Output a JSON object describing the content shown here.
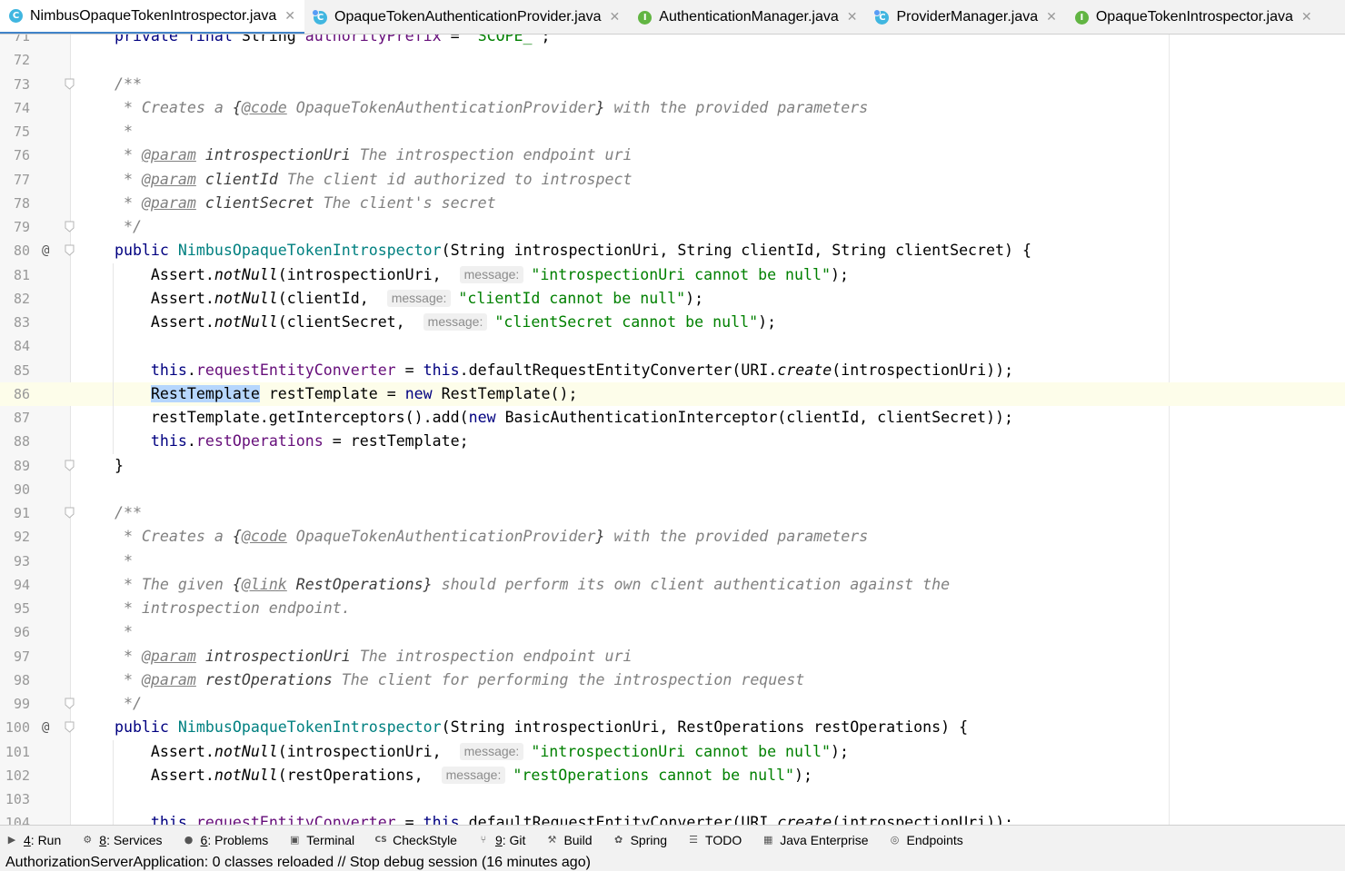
{
  "tabs": [
    {
      "label": "NimbusOpaqueTokenIntrospector.java",
      "icon": "class-icon",
      "kind": "C",
      "active": true
    },
    {
      "label": "OpaqueTokenAuthenticationProvider.java",
      "icon": "class-icon",
      "kind": "C",
      "active": false
    },
    {
      "label": "AuthenticationManager.java",
      "icon": "interface-icon",
      "kind": "I",
      "active": false
    },
    {
      "label": "ProviderManager.java",
      "icon": "class-icon",
      "kind": "C",
      "active": false
    },
    {
      "label": "OpaqueTokenIntrospector.java",
      "icon": "interface-icon",
      "kind": "I",
      "active": false
    }
  ],
  "editor": {
    "current_line": 86,
    "lines": [
      {
        "n": 71,
        "t": [
          [
            "kw",
            "    private final "
          ],
          [
            "",
            "String "
          ],
          [
            "fld",
            "authorityPrefix"
          ],
          [
            "",
            " = "
          ],
          [
            "str",
            "\"SCOPE_\""
          ],
          [
            "",
            ";"
          ]
        ]
      },
      {
        "n": 72,
        "t": []
      },
      {
        "n": 73,
        "fold": true,
        "t": [
          [
            "cm",
            "    /**"
          ]
        ]
      },
      {
        "n": 74,
        "t": [
          [
            "cm",
            "     * Creates a "
          ],
          [
            "par",
            "{"
          ],
          [
            "tag",
            "@code"
          ],
          [
            "cm",
            " OpaqueTokenAuthenticationProvider"
          ],
          [
            "par",
            "}"
          ],
          [
            "cm",
            " with the provided parameters"
          ]
        ]
      },
      {
        "n": 75,
        "t": [
          [
            "cm",
            "     *"
          ]
        ]
      },
      {
        "n": 76,
        "t": [
          [
            "cm",
            "     * "
          ],
          [
            "tag",
            "@param"
          ],
          [
            "cm",
            " "
          ],
          [
            "par",
            "introspectionUri"
          ],
          [
            "cm",
            " The introspection endpoint uri"
          ]
        ]
      },
      {
        "n": 77,
        "t": [
          [
            "cm",
            "     * "
          ],
          [
            "tag",
            "@param"
          ],
          [
            "cm",
            " "
          ],
          [
            "par",
            "clientId"
          ],
          [
            "cm",
            " The client id authorized to introspect"
          ]
        ]
      },
      {
        "n": 78,
        "t": [
          [
            "cm",
            "     * "
          ],
          [
            "tag",
            "@param"
          ],
          [
            "cm",
            " "
          ],
          [
            "par",
            "clientSecret"
          ],
          [
            "cm",
            " The client's secret"
          ]
        ]
      },
      {
        "n": 79,
        "fold": true,
        "t": [
          [
            "cm",
            "     */"
          ]
        ]
      },
      {
        "n": 80,
        "at": true,
        "fold": true,
        "t": [
          [
            "kw",
            "    public "
          ],
          [
            "mn",
            "NimbusOpaqueTokenIntrospector"
          ],
          [
            "",
            "(String introspectionUri, String clientId, String clientSecret) {"
          ]
        ]
      },
      {
        "n": 81,
        "t": [
          [
            "",
            "        Assert."
          ],
          [
            "mth",
            "notNull"
          ],
          [
            "",
            "(introspectionUri, "
          ],
          [
            "hint",
            "message:"
          ],
          [
            "str",
            "\"introspectionUri cannot be null\""
          ],
          [
            "",
            ");"
          ]
        ]
      },
      {
        "n": 82,
        "t": [
          [
            "",
            "        Assert."
          ],
          [
            "mth",
            "notNull"
          ],
          [
            "",
            "(clientId, "
          ],
          [
            "hint",
            "message:"
          ],
          [
            "str",
            "\"clientId cannot be null\""
          ],
          [
            "",
            ");"
          ]
        ]
      },
      {
        "n": 83,
        "t": [
          [
            "",
            "        Assert."
          ],
          [
            "mth",
            "notNull"
          ],
          [
            "",
            "(clientSecret, "
          ],
          [
            "hint",
            "message:"
          ],
          [
            "str",
            "\"clientSecret cannot be null\""
          ],
          [
            "",
            ");"
          ]
        ]
      },
      {
        "n": 84,
        "t": []
      },
      {
        "n": 85,
        "t": [
          [
            "kw",
            "        this"
          ],
          [
            "",
            "."
          ],
          [
            "fld",
            "requestEntityConverter"
          ],
          [
            "",
            " = "
          ],
          [
            "kw",
            "this"
          ],
          [
            "",
            ".defaultRequestEntityConverter(URI."
          ],
          [
            "mth",
            "create"
          ],
          [
            "",
            "(introspectionUri));"
          ]
        ]
      },
      {
        "n": 86,
        "t": [
          [
            "",
            "        "
          ],
          [
            "sel",
            "RestTemplate"
          ],
          [
            "",
            " restTemplate = "
          ],
          [
            "kw",
            "new "
          ],
          [
            "",
            "RestTemplate();"
          ]
        ]
      },
      {
        "n": 87,
        "t": [
          [
            "",
            "        restTemplate.getInterceptors().add("
          ],
          [
            "kw",
            "new "
          ],
          [
            "",
            "BasicAuthenticationInterceptor(clientId, clientSecret));"
          ]
        ]
      },
      {
        "n": 88,
        "t": [
          [
            "kw",
            "        this"
          ],
          [
            "",
            "."
          ],
          [
            "fld",
            "restOperations"
          ],
          [
            "",
            " = restTemplate;"
          ]
        ]
      },
      {
        "n": 89,
        "fold": true,
        "t": [
          [
            "",
            "    }"
          ]
        ]
      },
      {
        "n": 90,
        "t": []
      },
      {
        "n": 91,
        "fold": true,
        "t": [
          [
            "cm",
            "    /**"
          ]
        ]
      },
      {
        "n": 92,
        "t": [
          [
            "cm",
            "     * Creates a "
          ],
          [
            "par",
            "{"
          ],
          [
            "tag",
            "@code"
          ],
          [
            "cm",
            " OpaqueTokenAuthenticationProvider"
          ],
          [
            "par",
            "}"
          ],
          [
            "cm",
            " with the provided parameters"
          ]
        ]
      },
      {
        "n": 93,
        "t": [
          [
            "cm",
            "     *"
          ]
        ]
      },
      {
        "n": 94,
        "t": [
          [
            "cm",
            "     * The given "
          ],
          [
            "par",
            "{"
          ],
          [
            "tag",
            "@link"
          ],
          [
            "par",
            " RestOperations}"
          ],
          [
            "cm",
            " should perform its own client authentication against the"
          ]
        ]
      },
      {
        "n": 95,
        "t": [
          [
            "cm",
            "     * introspection endpoint."
          ]
        ]
      },
      {
        "n": 96,
        "t": [
          [
            "cm",
            "     *"
          ]
        ]
      },
      {
        "n": 97,
        "t": [
          [
            "cm",
            "     * "
          ],
          [
            "tag",
            "@param"
          ],
          [
            "cm",
            " "
          ],
          [
            "par",
            "introspectionUri"
          ],
          [
            "cm",
            " The introspection endpoint uri"
          ]
        ]
      },
      {
        "n": 98,
        "t": [
          [
            "cm",
            "     * "
          ],
          [
            "tag",
            "@param"
          ],
          [
            "cm",
            " "
          ],
          [
            "par",
            "restOperations"
          ],
          [
            "cm",
            " The client for performing the introspection request"
          ]
        ]
      },
      {
        "n": 99,
        "fold": true,
        "t": [
          [
            "cm",
            "     */"
          ]
        ]
      },
      {
        "n": 100,
        "at": true,
        "fold": true,
        "t": [
          [
            "kw",
            "    public "
          ],
          [
            "mn",
            "NimbusOpaqueTokenIntrospector"
          ],
          [
            "",
            "(String introspectionUri, RestOperations restOperations) {"
          ]
        ]
      },
      {
        "n": 101,
        "t": [
          [
            "",
            "        Assert."
          ],
          [
            "mth",
            "notNull"
          ],
          [
            "",
            "(introspectionUri, "
          ],
          [
            "hint",
            "message:"
          ],
          [
            "str",
            "\"introspectionUri cannot be null\""
          ],
          [
            "",
            ");"
          ]
        ]
      },
      {
        "n": 102,
        "t": [
          [
            "",
            "        Assert."
          ],
          [
            "mth",
            "notNull"
          ],
          [
            "",
            "(restOperations, "
          ],
          [
            "hint",
            "message:"
          ],
          [
            "str",
            "\"restOperations cannot be null\""
          ],
          [
            "",
            ");"
          ]
        ]
      },
      {
        "n": 103,
        "t": []
      },
      {
        "n": 104,
        "t": [
          [
            "kw",
            "        this"
          ],
          [
            "",
            "."
          ],
          [
            "fld",
            "requestEntityConverter"
          ],
          [
            "",
            " = "
          ],
          [
            "kw",
            "this"
          ],
          [
            "",
            ".defaultRequestEntityConverter(URI."
          ],
          [
            "mth",
            "create"
          ],
          [
            "",
            "(introspectionUri));"
          ]
        ]
      }
    ]
  },
  "toolstrip": [
    {
      "key": "4",
      "label": ": Run",
      "icon": "run-icon"
    },
    {
      "key": "8",
      "label": ": Services",
      "icon": "services-icon"
    },
    {
      "key": "6",
      "label": ": Problems",
      "icon": "problems-icon"
    },
    {
      "key": "",
      "label": "Terminal",
      "icon": "terminal-icon"
    },
    {
      "key": "",
      "label": "CheckStyle",
      "icon": "checkstyle-icon"
    },
    {
      "key": "9",
      "label": ": Git",
      "icon": "git-icon"
    },
    {
      "key": "",
      "label": "Build",
      "icon": "build-icon"
    },
    {
      "key": "",
      "label": "Spring",
      "icon": "spring-icon"
    },
    {
      "key": "",
      "label": "TODO",
      "icon": "todo-icon"
    },
    {
      "key": "",
      "label": "Java Enterprise",
      "icon": "java-enterprise-icon"
    },
    {
      "key": "",
      "label": "Endpoints",
      "icon": "endpoints-icon"
    }
  ],
  "status": {
    "message": "AuthorizationServerApplication: 0 classes reloaded // Stop debug session (16 minutes ago)"
  },
  "colors": {
    "keyword": "#000080",
    "string": "#008000",
    "field": "#660e7a",
    "comment": "#808080",
    "selection": "#b6d6fd",
    "current_line": "#fdfdea",
    "active_tab_underline": "#4083c9"
  }
}
